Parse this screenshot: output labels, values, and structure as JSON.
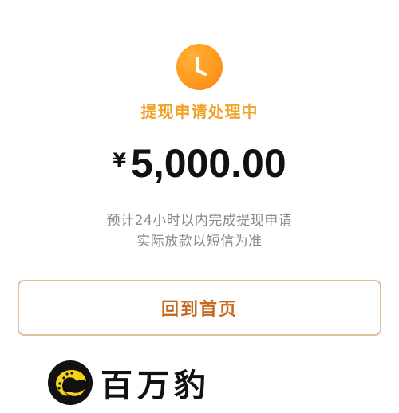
{
  "status": {
    "icon": "clock-icon",
    "icon_color": "#ff9a1e",
    "title": "提现申请处理中",
    "title_color": "#f0a329"
  },
  "amount": {
    "currency": "¥",
    "value": "5,000.00"
  },
  "notes": {
    "line1": "预计24小时以内完成提现申请",
    "line2": "实际放款以短信为准"
  },
  "actions": {
    "home_label": "回到首页",
    "home_color": "#c66a20"
  },
  "watermark": {
    "logo": "leopard-logo-icon",
    "text": "百万豹"
  }
}
